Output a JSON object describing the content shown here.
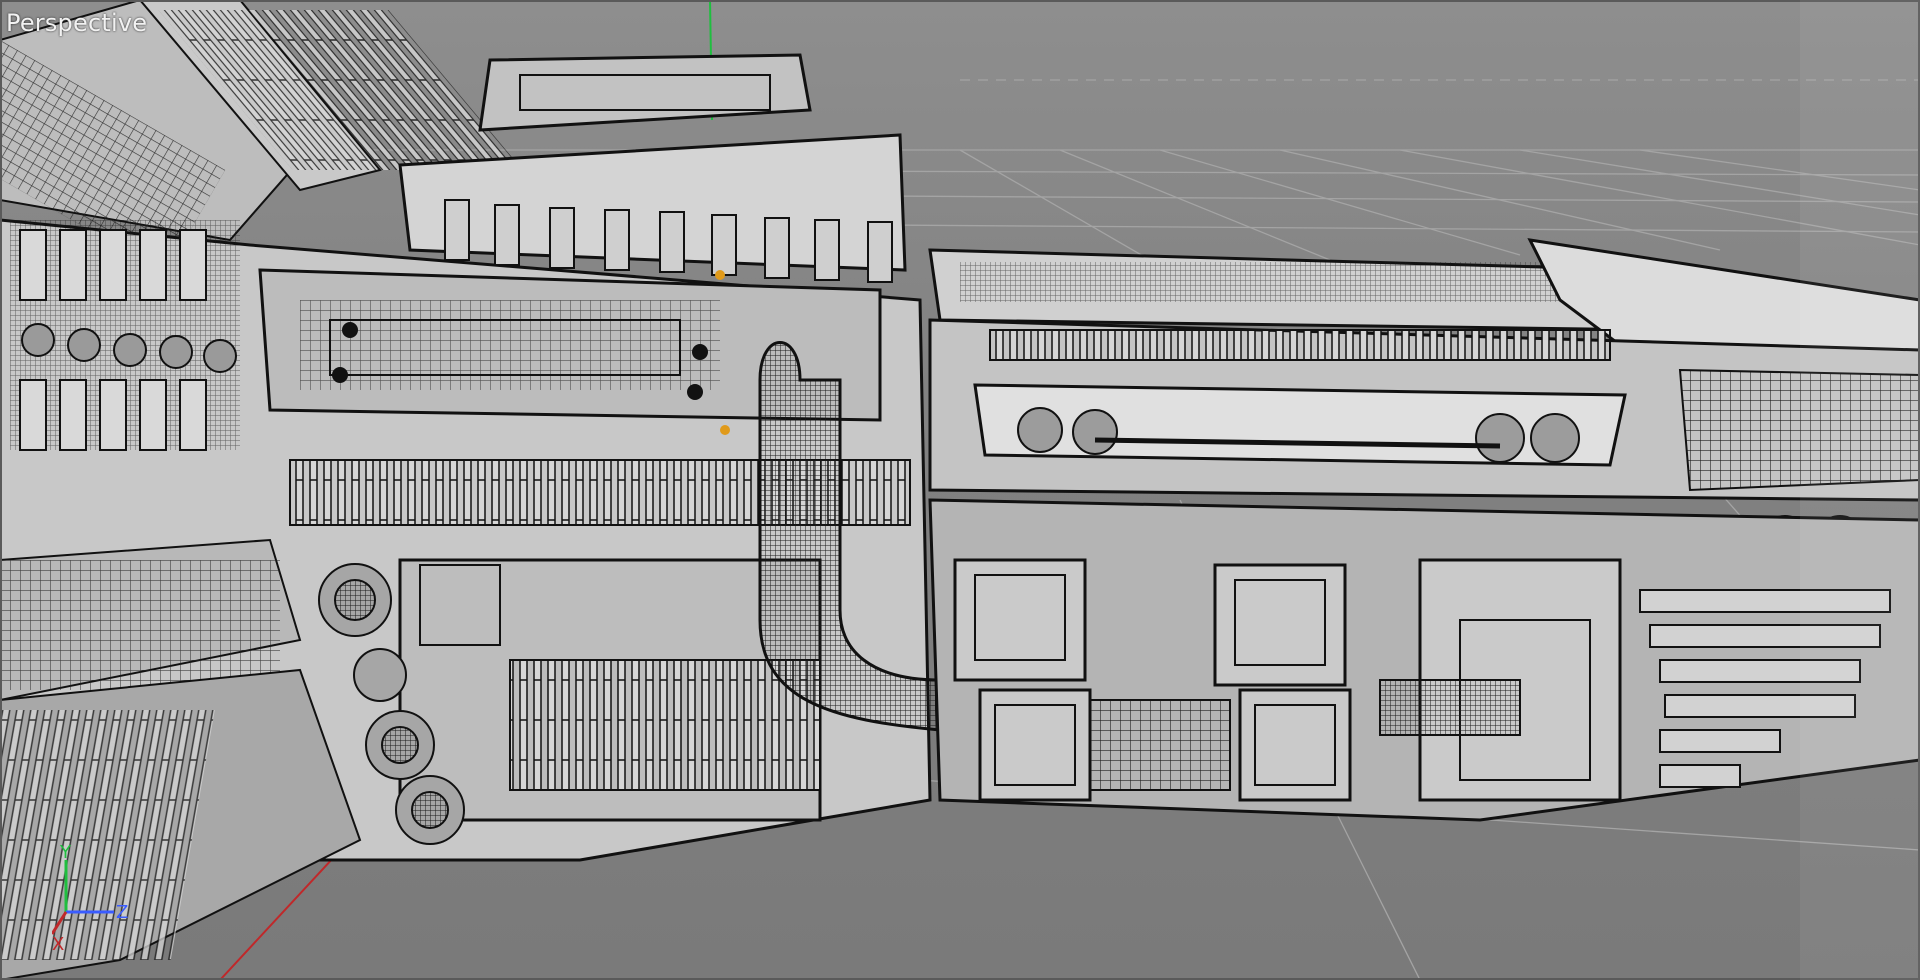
{
  "viewport": {
    "label": "Perspective",
    "background_color": "#7d7d7d",
    "object_color": "#cfcfcf",
    "wire_color": "#151515",
    "grid_color": "#9a9a9a",
    "axis_colors": {
      "x": "#c0282a",
      "y": "#1fbf3f",
      "z": "#3a5cff"
    }
  },
  "gizmo": {
    "x_label": "X",
    "y_label": "Y",
    "z_label": "Z"
  }
}
